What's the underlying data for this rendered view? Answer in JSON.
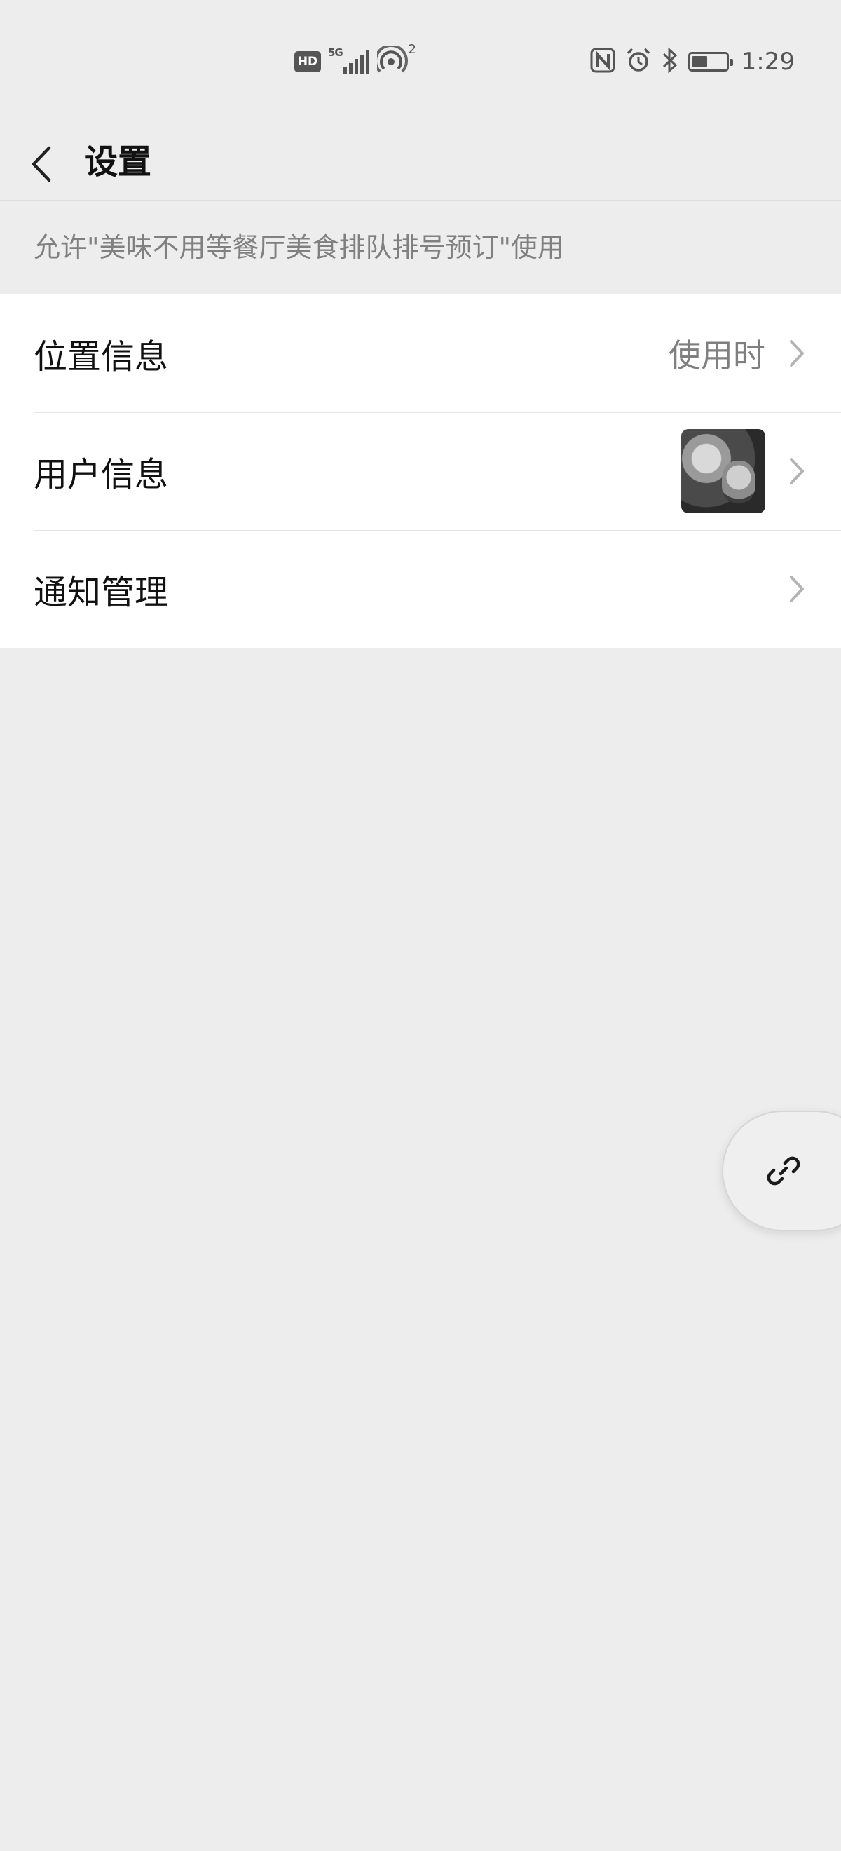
{
  "status_bar": {
    "hd_badge": "HD",
    "network_label": "5G",
    "hotspot_count": "2",
    "time": "1:29",
    "battery_level": 0.45,
    "icons": [
      "hd-icon",
      "signal-icon",
      "hotspot-icon",
      "nfc-icon",
      "alarm-icon",
      "bluetooth-icon",
      "battery-icon"
    ]
  },
  "header": {
    "title": "设置",
    "back_icon": "chevron-left-icon"
  },
  "permission_hint": "允许\"美味不用等餐厅美食排队排号预订\"使用",
  "settings": {
    "items": [
      {
        "label": "位置信息",
        "value": "使用时",
        "trailing": "chevron-right-icon"
      },
      {
        "label": "用户信息",
        "value": "",
        "trailing": "chevron-right-icon",
        "has_avatar": true
      },
      {
        "label": "通知管理",
        "value": "",
        "trailing": "chevron-right-icon"
      }
    ]
  },
  "floating_button": {
    "icon": "link-icon"
  },
  "colors": {
    "background": "#ededed",
    "list_background": "#ffffff",
    "secondary_text": "#808080",
    "primary_text": "#111111"
  }
}
